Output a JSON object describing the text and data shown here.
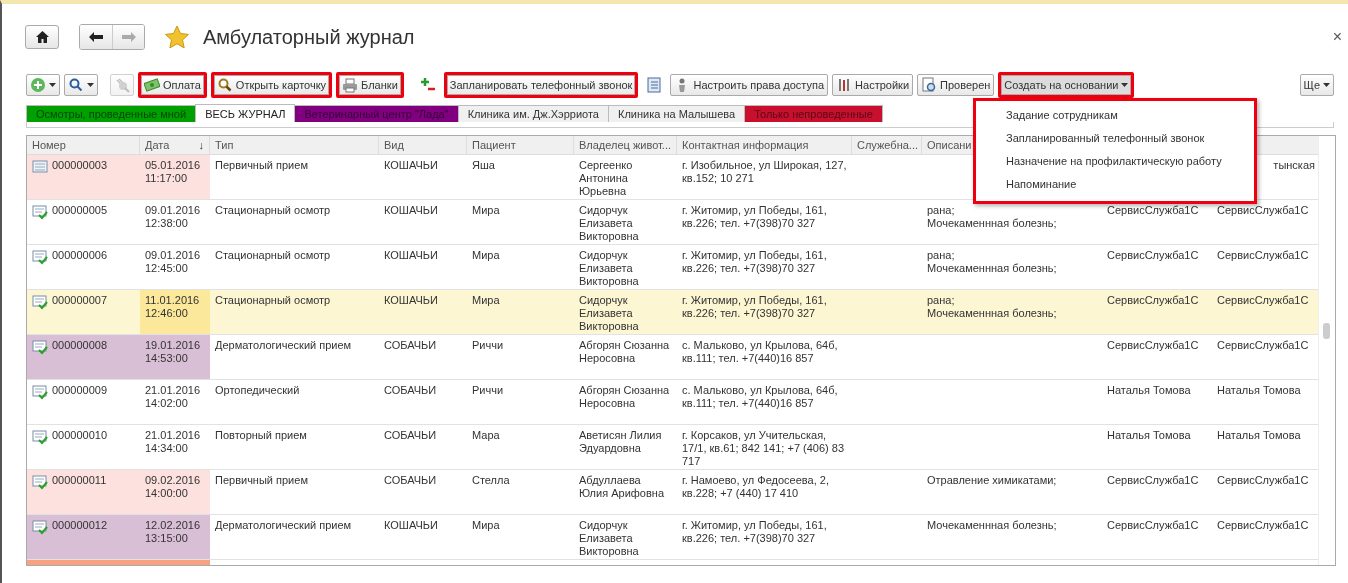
{
  "header": {
    "title": "Амбулаторный журнал",
    "favorite": true,
    "close": "×"
  },
  "toolbar": [
    {
      "kind": "icon-menu",
      "disabled": false,
      "highlighted": false,
      "expanded": false
    },
    {
      "kind": "icon-menu",
      "disabled": false,
      "highlighted": false,
      "expanded": false
    },
    {
      "kind": "icon",
      "disabled": true,
      "highlighted": false
    },
    {
      "kind": "button",
      "label": "Оплата",
      "disabled": false,
      "highlighted": true
    },
    {
      "kind": "button",
      "label": "Открыть карточку",
      "disabled": false,
      "highlighted": true
    },
    {
      "kind": "button",
      "label": "Бланки",
      "disabled": false,
      "highlighted": true
    },
    {
      "kind": "icon",
      "disabled": false,
      "highlighted": false
    },
    {
      "kind": "button",
      "label": "Запланировать телефонный звонок",
      "disabled": false,
      "highlighted": true
    },
    {
      "kind": "icon",
      "disabled": false,
      "highlighted": false
    },
    {
      "kind": "button",
      "label": "Настроить права доступа",
      "disabled": false,
      "highlighted": false
    },
    {
      "kind": "button",
      "label": "Настройки",
      "disabled": false,
      "highlighted": false
    },
    {
      "kind": "button",
      "label": "Проверен",
      "disabled": false,
      "highlighted": false
    },
    {
      "kind": "menu",
      "label": "Создать на основании",
      "disabled": false,
      "highlighted": true,
      "expanded": true
    }
  ],
  "more_button": {
    "label": "Ще"
  },
  "dropdown_menu": {
    "items": [
      "Задание сотрудникам",
      "Запланированный телефонный звонок",
      "Назначение на профилактическую работу",
      "Напоминание"
    ]
  },
  "tabs": [
    {
      "label": "Осмотры, проведенные мной",
      "selected": false,
      "color": "#00a000"
    },
    {
      "label": "ВЕСЬ ЖУРНАЛ",
      "selected": true,
      "color": "#ffffff"
    },
    {
      "label": "Ветеринарный центр \"Лада\"",
      "selected": false,
      "color": "#800080"
    },
    {
      "label": "Клиника им. Дж.Хэрриота",
      "selected": false,
      "color": "#f0f0f0"
    },
    {
      "label": "Клиника на Малышева",
      "selected": false,
      "color": "#f0f0f0"
    },
    {
      "label": "Только непроведенные",
      "selected": false,
      "color": "#c8102e"
    }
  ],
  "table": {
    "columns": [
      {
        "label": "Номер"
      },
      {
        "label": "Дата",
        "sort_mark": "↓"
      },
      {
        "label": "Тип"
      },
      {
        "label": "Вид"
      },
      {
        "label": "Пациент"
      },
      {
        "label": "Владелец живот..."
      },
      {
        "label": "Контактная информация"
      },
      {
        "label": "Служебна..."
      },
      {
        "label": "Описани"
      }
    ],
    "rows": [
      {
        "selected": false,
        "posted": false,
        "color": "#fde1df",
        "number": "000000003",
        "date": "05.01.2016 11:17:00",
        "type": "Первичный прием",
        "species": "КОШАЧЬИ",
        "patient": "Яша",
        "owner": "Сергеенко Антонина Юрьевна",
        "contact": "г. Изобильное, ул Широкая, 127, кв.152; 10 271",
        "column_11": "тынская"
      },
      {
        "selected": false,
        "posted": true,
        "number": "000000005",
        "date": "09.01.2016 12:38:00",
        "type": "Стационарный осмотр",
        "species": "КОШАЧЬИ",
        "patient": "Мира",
        "owner": "Сидорчук Елизавета Викторовна",
        "contact": "г. Житомир, ул Победы, 161, кв.226; тел. +7(398)70 327",
        "description": "рана;\nМочекаменнная болезнь;",
        "column_10": "СервисСлужба1С",
        "column_11": "СервисСлужба1С"
      },
      {
        "selected": false,
        "posted": true,
        "number": "000000006",
        "date": "09.01.2016 12:45:00",
        "type": "Стационарный осмотр",
        "species": "КОШАЧЬИ",
        "patient": "Мира",
        "owner": "Сидорчук Елизавета Викторовна",
        "contact": "г. Житомир, ул Победы, 161, кв.226; тел. +7(398)70 327",
        "description": "рана;\nМочекаменнная болезнь;",
        "column_10": "СервисСлужба1С",
        "column_11": "СервисСлужба1С"
      },
      {
        "selected": true,
        "posted": true,
        "number": "000000007",
        "date": "11.01.2016 12:46:00",
        "type": "Стационарный осмотр",
        "species": "КОШАЧЬИ",
        "patient": "Мира",
        "owner": "Сидорчук Елизавета Викторовна",
        "contact": "г. Житомир, ул Победы, 161, кв.226; тел. +7(398)70 327",
        "description": "рана;\nМочекаменнная болезнь;",
        "column_10": "СервисСлужба1С",
        "column_11": "СервисСлужба1С"
      },
      {
        "selected": false,
        "posted": true,
        "color": "#d9bfd6",
        "number": "000000008",
        "date": "19.01.2016 14:53:00",
        "type": "Дерматологический прием",
        "species": "СОБАЧЬИ",
        "patient": "Риччи",
        "owner": "Абгорян Сюзанна Неросовна",
        "contact": "с. Мальково, ул Крылова, 64б, кв.111; тел. +7(440)16 857",
        "column_10": "СервисСлужба1С",
        "column_11": "СервисСлужба1С"
      },
      {
        "selected": false,
        "posted": true,
        "number": "000000009",
        "date": "21.01.2016 14:02:00",
        "type": "Ортопедический",
        "species": "СОБАЧЬИ",
        "patient": "Риччи",
        "owner": "Абгорян Сюзанна Неросовна",
        "contact": "с. Мальково, ул Крылова, 64б, кв.111; тел. +7(440)16 857",
        "column_10": "Наталья Томова",
        "column_11": "Наталья Томова"
      },
      {
        "selected": false,
        "posted": true,
        "number": "000000010",
        "date": "21.01.2016 14:34:00",
        "type": "Повторный прием",
        "species": "СОБАЧЬИ",
        "patient": "Мара",
        "owner": "Аветисян Лилия Эдуардовна",
        "contact": "г. Корсаков, ул Учительская, 17/1, кв.61; 842 141; +7  (406) 83 717",
        "column_10": "Наталья Томова",
        "column_11": "Наталья Томова"
      },
      {
        "selected": false,
        "posted": true,
        "color": "#fde1df",
        "number": "000000011",
        "date": "09.02.2016 14:00:00",
        "type": "Первичный прием",
        "species": "СОБАЧЬИ",
        "patient": "Стелла",
        "owner": "Абдуллаева Юлия Арифовна",
        "contact": "г. Намоево, ул Федосеева, 2, кв.228; +7  (440)  17 410",
        "description": "Отравление химикатами;",
        "column_10": "СервисСлужба1С",
        "column_11": "СервисСлужба1С"
      },
      {
        "selected": false,
        "posted": true,
        "color": "#d9bfd6",
        "number": "000000012",
        "date": "12.02.2016 13:15:00",
        "type": "Дерматологический прием",
        "species": "КОШАЧЬИ",
        "patient": "Мира",
        "owner": "Сидорчук Елизавета Викторовна",
        "contact": "г. Житомир, ул Победы, 161, кв.226; тел. +7(398)70 327",
        "description": "Мочекаменнная болезнь;",
        "column_10": "СервисСлужба1С",
        "column_11": "СервисСлужба1С"
      },
      {
        "selected": false,
        "color": "#f9a27f"
      }
    ]
  }
}
